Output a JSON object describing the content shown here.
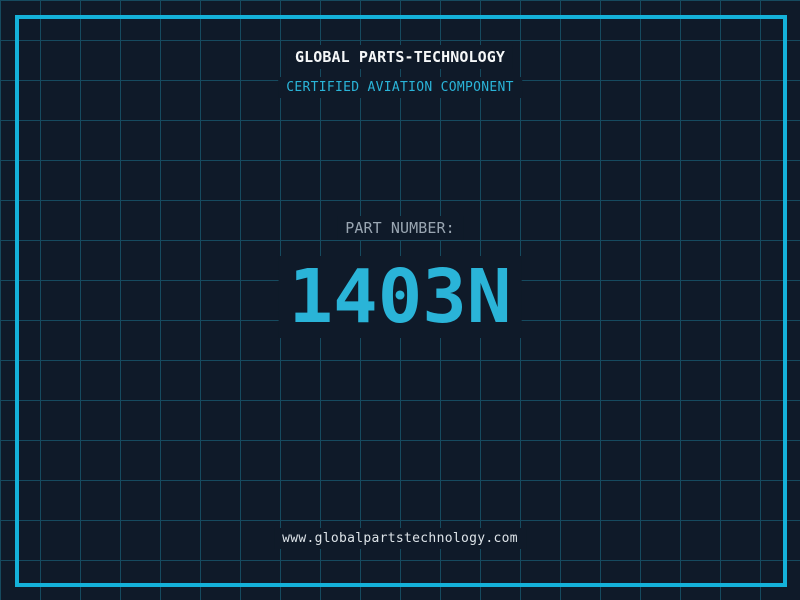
{
  "header": {
    "title": "GLOBAL PARTS-TECHNOLOGY",
    "subtitle": "CERTIFIED AVIATION COMPONENT"
  },
  "part": {
    "label": "PART NUMBER:",
    "number": "1403N"
  },
  "footer": {
    "url": "www.globalpartstechnology.com"
  },
  "colors": {
    "background": "#0f1a29",
    "grid_line": "#164a5f",
    "frame_border": "#14b1d9",
    "accent_cyan": "#2ab4d8",
    "title_white": "#f5f7f8",
    "label_gray": "#9aa6b2",
    "footer_gray": "#dde3e8"
  }
}
